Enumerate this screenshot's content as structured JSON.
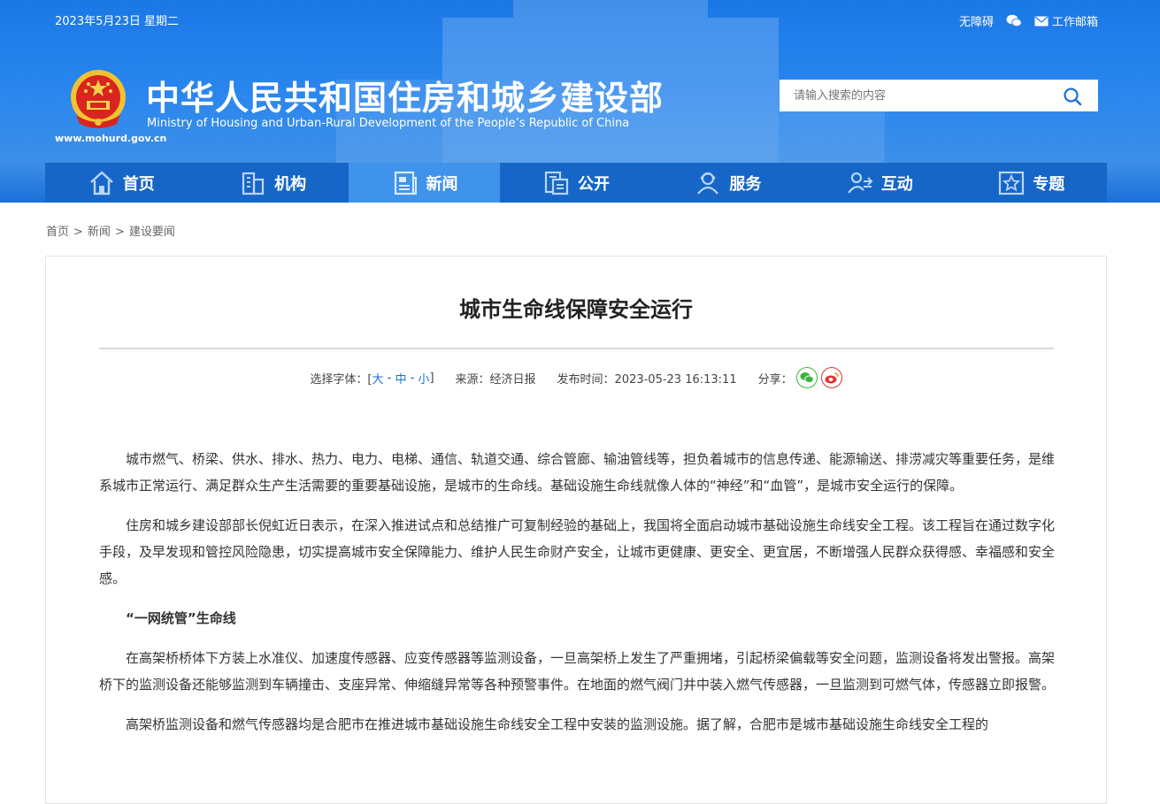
{
  "top_bar": {
    "date": "2023年5月23日 星期二",
    "accessibility": "无障碍",
    "wechat_icon": "wechat-icon",
    "mail": "工作邮箱"
  },
  "brand": {
    "title_cn": "中华人民共和国住房和城乡建设部",
    "title_en": "Ministry of Housing and Urban-Rural Development of the People’s Republic of China",
    "url": "www.mohurd.gov.cn"
  },
  "search": {
    "placeholder": "请输入搜索的内容"
  },
  "nav": {
    "items": [
      {
        "label": "首页",
        "icon": "home-icon"
      },
      {
        "label": "机构",
        "icon": "building-icon"
      },
      {
        "label": "新闻",
        "icon": "news-icon"
      },
      {
        "label": "公开",
        "icon": "document-icon"
      },
      {
        "label": "服务",
        "icon": "service-icon"
      },
      {
        "label": "互动",
        "icon": "interaction-icon"
      },
      {
        "label": "专题",
        "icon": "star-icon"
      }
    ],
    "active": "新闻"
  },
  "breadcrumb": [
    "首页",
    "新闻",
    "建设要闻"
  ],
  "article": {
    "title": "城市生命线保障安全运行",
    "font_label": "选择字体：[",
    "font_large": "大",
    "font_medium": "中",
    "font_small": "小",
    "font_close": "]",
    "source": "来源：经济日报",
    "publish_time": "发布时间：2023-05-23 16:13:11",
    "share_label": "分享：",
    "p1": "城市燃气、桥梁、供水、排水、热力、电力、电梯、通信、轨道交通、综合管廊、输油管线等，担负着城市的信息传递、能源输送、排涝减灾等重要任务，是维系城市正常运行、满足群众生产生活需要的重要基础设施，是城市的生命线。基础设施生命线就像人体的“神经”和“血管”，是城市安全运行的保障。",
    "p2": "住房和城乡建设部部长倪虹近日表示，在深入推进试点和总结推广可复制经验的基础上，我国将全面启动城市基础设施生命线安全工程。该工程旨在通过数字化手段，及早发现和管控风险隐患，切实提高城市安全保障能力、维护人民生命财产安全，让城市更健康、更安全、更宜居，不断增强人民群众获得感、幸福感和安全感。",
    "subhead": "“一网统管”生命线",
    "p3": "在高架桥桥体下方装上水准仪、加速度传感器、应变传感器等监测设备，一旦高架桥上发生了严重拥堵，引起桥梁偏载等安全问题，监测设备将发出警报。高架桥下的监测设备还能够监测到车辆撞击、支座异常、伸缩缝异常等各种预警事件。在地面的燃气阀门井中装入燃气传感器，一旦监测到可燃气体，传感器立即报警。",
    "p4": "高架桥监测设备和燃气传感器均是合肥市在推进城市基础设施生命线安全工程中安装的监测设施。据了解，合肥市是城市基础设施生命线安全工程的"
  }
}
